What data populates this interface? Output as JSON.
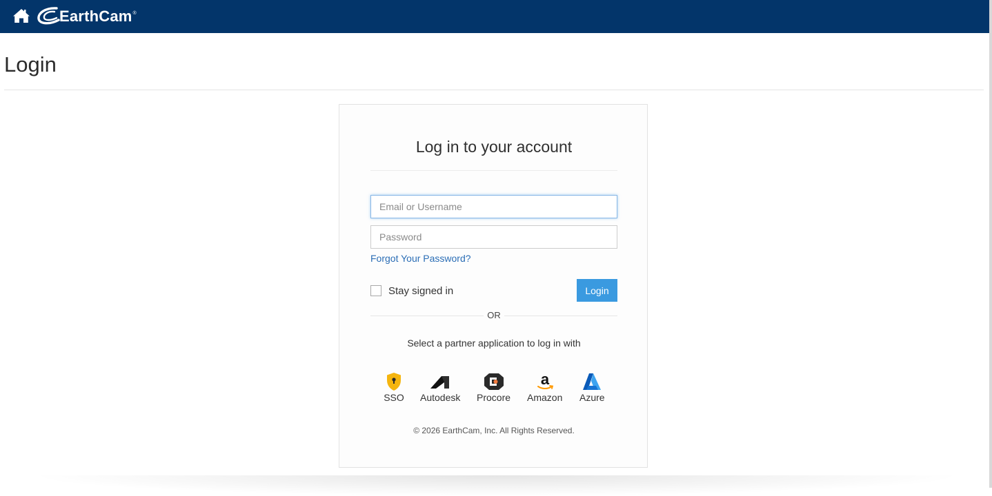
{
  "header": {
    "brand_name": "EarthCam",
    "brand_mark": "®",
    "home_icon": "home-icon",
    "background_color": "#03356a"
  },
  "page": {
    "title": "Login"
  },
  "login_card": {
    "heading": "Log in to your account",
    "email_placeholder": "Email or Username",
    "password_placeholder": "Password",
    "forgot_password": "Forgot Your Password?",
    "stay_signed_in": "Stay signed in",
    "stay_signed_in_checked": false,
    "login_button": "Login",
    "login_button_color": "#3a9ae0",
    "separator": "OR",
    "partner_prompt": "Select a partner application to log in with",
    "partners": [
      {
        "label": "SSO",
        "icon": "sso-shield-icon"
      },
      {
        "label": "Autodesk",
        "icon": "autodesk-icon"
      },
      {
        "label": "Procore",
        "icon": "procore-icon"
      },
      {
        "label": "Amazon",
        "icon": "amazon-icon"
      },
      {
        "label": "Azure",
        "icon": "azure-icon"
      }
    ],
    "copyright": "© 2026 EarthCam, Inc. All Rights Reserved."
  }
}
